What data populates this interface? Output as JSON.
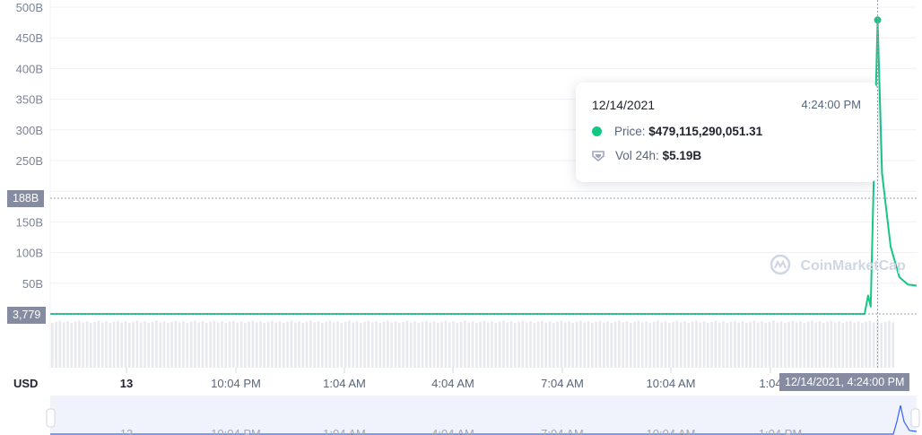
{
  "chart_data": {
    "type": "line",
    "y_ticks": [
      "500B",
      "450B",
      "400B",
      "350B",
      "300B",
      "250B",
      "150B",
      "100B",
      "50B"
    ],
    "ylim": [
      0,
      500000000000
    ],
    "y_unit_label": "USD",
    "x_ticks": [
      "13",
      "10:04 PM",
      "1:04 AM",
      "4:04 AM",
      "7:04 AM",
      "10:04 AM",
      "1:04"
    ],
    "x_bold_ticks": [
      "13"
    ],
    "series": [
      {
        "color": "#16c784",
        "x": [
          0,
          0.9,
          0.94,
          0.944,
          0.947,
          0.951,
          0.955,
          0.96,
          0.97,
          0.98,
          0.99,
          1.0
        ],
        "y": [
          0,
          0,
          0,
          30000000000,
          12000000000,
          250000000000,
          479115290051,
          230000000000,
          110000000000,
          60000000000,
          48000000000,
          46000000000
        ]
      }
    ],
    "crosshair_y_label": "188B",
    "current_price_label": "3,779",
    "crosshair_x_label": "12/14/2021, 4:24:00 PM",
    "grid": true,
    "tooltip": {
      "date": "12/14/2021",
      "time": "4:24:00 PM",
      "price_label": "Price:",
      "price_value": "$479,115,290,051.31",
      "vol_label": "Vol 24h:",
      "vol_value": "$5.19B"
    },
    "watermark": "CoinMarketCap",
    "navigator_ticks": [
      "13",
      "10:04 PM",
      "1:04 AM",
      "4:04 AM",
      "7:04 AM",
      "10:04 AM",
      "1:04 PM"
    ]
  }
}
